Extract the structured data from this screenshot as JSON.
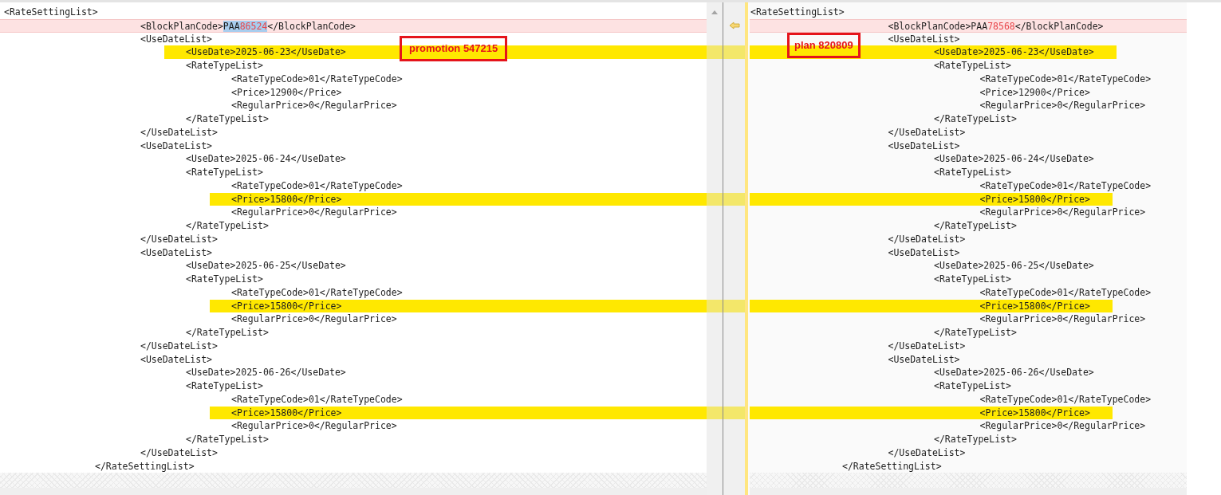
{
  "left_pane": {
    "annotation": {
      "text": "promotion 547215"
    },
    "lines": [
      {
        "text": "<RateSettingList>",
        "changed": false,
        "marked": false
      },
      {
        "segments": [
          {
            "text": "\t\t\t<BlockPlanCode>",
            "selected": false,
            "changed": false
          },
          {
            "text": "PAA",
            "selected": true,
            "changed": false
          },
          {
            "text": "86524",
            "selected": true,
            "changed": true
          },
          {
            "text": "</BlockPlanCode>",
            "selected": false,
            "changed": false
          }
        ],
        "changed": true,
        "marked": false
      },
      {
        "text": "\t\t\t<UseDateList>",
        "changed": false,
        "marked": false
      },
      {
        "text": "\t\t\t\t<UseDate>2025-06-23</UseDate>",
        "changed": false,
        "marked": true
      },
      {
        "text": "\t\t\t\t<RateTypeList>",
        "changed": false,
        "marked": false
      },
      {
        "text": "\t\t\t\t\t<RateTypeCode>01</RateTypeCode>",
        "changed": false,
        "marked": false
      },
      {
        "text": "\t\t\t\t\t<Price>12900</Price>",
        "changed": false,
        "marked": false
      },
      {
        "text": "\t\t\t\t\t<RegularPrice>0</RegularPrice>",
        "changed": false,
        "marked": false
      },
      {
        "text": "\t\t\t\t</RateTypeList>",
        "changed": false,
        "marked": false
      },
      {
        "text": "\t\t\t</UseDateList>",
        "changed": false,
        "marked": false
      },
      {
        "text": "\t\t\t<UseDateList>",
        "changed": false,
        "marked": false
      },
      {
        "text": "\t\t\t\t<UseDate>2025-06-24</UseDate>",
        "changed": false,
        "marked": false
      },
      {
        "text": "\t\t\t\t<RateTypeList>",
        "changed": false,
        "marked": false
      },
      {
        "text": "\t\t\t\t\t<RateTypeCode>01</RateTypeCode>",
        "changed": false,
        "marked": false
      },
      {
        "text": "\t\t\t\t\t<Price>15800</Price>",
        "changed": false,
        "marked": true
      },
      {
        "text": "\t\t\t\t\t<RegularPrice>0</RegularPrice>",
        "changed": false,
        "marked": false
      },
      {
        "text": "\t\t\t\t</RateTypeList>",
        "changed": false,
        "marked": false
      },
      {
        "text": "\t\t\t</UseDateList>",
        "changed": false,
        "marked": false
      },
      {
        "text": "\t\t\t<UseDateList>",
        "changed": false,
        "marked": false
      },
      {
        "text": "\t\t\t\t<UseDate>2025-06-25</UseDate>",
        "changed": false,
        "marked": false
      },
      {
        "text": "\t\t\t\t<RateTypeList>",
        "changed": false,
        "marked": false
      },
      {
        "text": "\t\t\t\t\t<RateTypeCode>01</RateTypeCode>",
        "changed": false,
        "marked": false
      },
      {
        "text": "\t\t\t\t\t<Price>15800</Price>",
        "changed": false,
        "marked": true
      },
      {
        "text": "\t\t\t\t\t<RegularPrice>0</RegularPrice>",
        "changed": false,
        "marked": false
      },
      {
        "text": "\t\t\t\t</RateTypeList>",
        "changed": false,
        "marked": false
      },
      {
        "text": "\t\t\t</UseDateList>",
        "changed": false,
        "marked": false
      },
      {
        "text": "\t\t\t<UseDateList>",
        "changed": false,
        "marked": false
      },
      {
        "text": "\t\t\t\t<UseDate>2025-06-26</UseDate>",
        "changed": false,
        "marked": false
      },
      {
        "text": "\t\t\t\t<RateTypeList>",
        "changed": false,
        "marked": false
      },
      {
        "text": "\t\t\t\t\t<RateTypeCode>01</RateTypeCode>",
        "changed": false,
        "marked": false
      },
      {
        "text": "\t\t\t\t\t<Price>15800</Price>",
        "changed": false,
        "marked": true
      },
      {
        "text": "\t\t\t\t\t<RegularPrice>0</RegularPrice>",
        "changed": false,
        "marked": false
      },
      {
        "text": "\t\t\t\t</RateTypeList>",
        "changed": false,
        "marked": false
      },
      {
        "text": "\t\t\t</UseDateList>",
        "changed": false,
        "marked": false
      },
      {
        "text": "\t\t</RateSettingList>",
        "changed": false,
        "marked": false
      }
    ]
  },
  "right_pane": {
    "annotation": {
      "text": "plan 820809"
    },
    "lines": [
      {
        "text": "<RateSettingList>",
        "changed": false,
        "marked": false
      },
      {
        "segments": [
          {
            "text": "\t\t\t<BlockPlanCode>PAA",
            "selected": false,
            "changed": false
          },
          {
            "text": "78568",
            "selected": false,
            "changed": true
          },
          {
            "text": "</BlockPlanCode>",
            "selected": false,
            "changed": false
          }
        ],
        "changed": true,
        "marked": false
      },
      {
        "text": "\t\t\t<UseDateList>",
        "changed": false,
        "marked": false
      },
      {
        "text": "\t\t\t\t<UseDate>2025-06-23</UseDate>",
        "changed": false,
        "marked": true
      },
      {
        "text": "\t\t\t\t<RateTypeList>",
        "changed": false,
        "marked": false
      },
      {
        "text": "\t\t\t\t\t<RateTypeCode>01</RateTypeCode>",
        "changed": false,
        "marked": false
      },
      {
        "text": "\t\t\t\t\t<Price>12900</Price>",
        "changed": false,
        "marked": false
      },
      {
        "text": "\t\t\t\t\t<RegularPrice>0</RegularPrice>",
        "changed": false,
        "marked": false
      },
      {
        "text": "\t\t\t\t</RateTypeList>",
        "changed": false,
        "marked": false
      },
      {
        "text": "\t\t\t</UseDateList>",
        "changed": false,
        "marked": false
      },
      {
        "text": "\t\t\t<UseDateList>",
        "changed": false,
        "marked": false
      },
      {
        "text": "\t\t\t\t<UseDate>2025-06-24</UseDate>",
        "changed": false,
        "marked": false
      },
      {
        "text": "\t\t\t\t<RateTypeList>",
        "changed": false,
        "marked": false
      },
      {
        "text": "\t\t\t\t\t<RateTypeCode>01</RateTypeCode>",
        "changed": false,
        "marked": false
      },
      {
        "text": "\t\t\t\t\t<Price>15800</Price>",
        "changed": false,
        "marked": true
      },
      {
        "text": "\t\t\t\t\t<RegularPrice>0</RegularPrice>",
        "changed": false,
        "marked": false
      },
      {
        "text": "\t\t\t\t</RateTypeList>",
        "changed": false,
        "marked": false
      },
      {
        "text": "\t\t\t</UseDateList>",
        "changed": false,
        "marked": false
      },
      {
        "text": "\t\t\t<UseDateList>",
        "changed": false,
        "marked": false
      },
      {
        "text": "\t\t\t\t<UseDate>2025-06-25</UseDate>",
        "changed": false,
        "marked": false
      },
      {
        "text": "\t\t\t\t<RateTypeList>",
        "changed": false,
        "marked": false
      },
      {
        "text": "\t\t\t\t\t<RateTypeCode>01</RateTypeCode>",
        "changed": false,
        "marked": false
      },
      {
        "text": "\t\t\t\t\t<Price>15800</Price>",
        "changed": false,
        "marked": true
      },
      {
        "text": "\t\t\t\t\t<RegularPrice>0</RegularPrice>",
        "changed": false,
        "marked": false
      },
      {
        "text": "\t\t\t\t</RateTypeList>",
        "changed": false,
        "marked": false
      },
      {
        "text": "\t\t\t</UseDateList>",
        "changed": false,
        "marked": false
      },
      {
        "text": "\t\t\t<UseDateList>",
        "changed": false,
        "marked": false
      },
      {
        "text": "\t\t\t\t<UseDate>2025-06-26</UseDate>",
        "changed": false,
        "marked": false
      },
      {
        "text": "\t\t\t\t<RateTypeList>",
        "changed": false,
        "marked": false
      },
      {
        "text": "\t\t\t\t\t<RateTypeCode>01</RateTypeCode>",
        "changed": false,
        "marked": false
      },
      {
        "text": "\t\t\t\t\t<Price>15800</Price>",
        "changed": false,
        "marked": true
      },
      {
        "text": "\t\t\t\t\t<RegularPrice>0</RegularPrice>",
        "changed": false,
        "marked": false
      },
      {
        "text": "\t\t\t\t</RateTypeList>",
        "changed": false,
        "marked": false
      },
      {
        "text": "\t\t\t</UseDateList>",
        "changed": false,
        "marked": false
      },
      {
        "text": "\t\t</RateSettingList>",
        "changed": false,
        "marked": false
      }
    ]
  }
}
